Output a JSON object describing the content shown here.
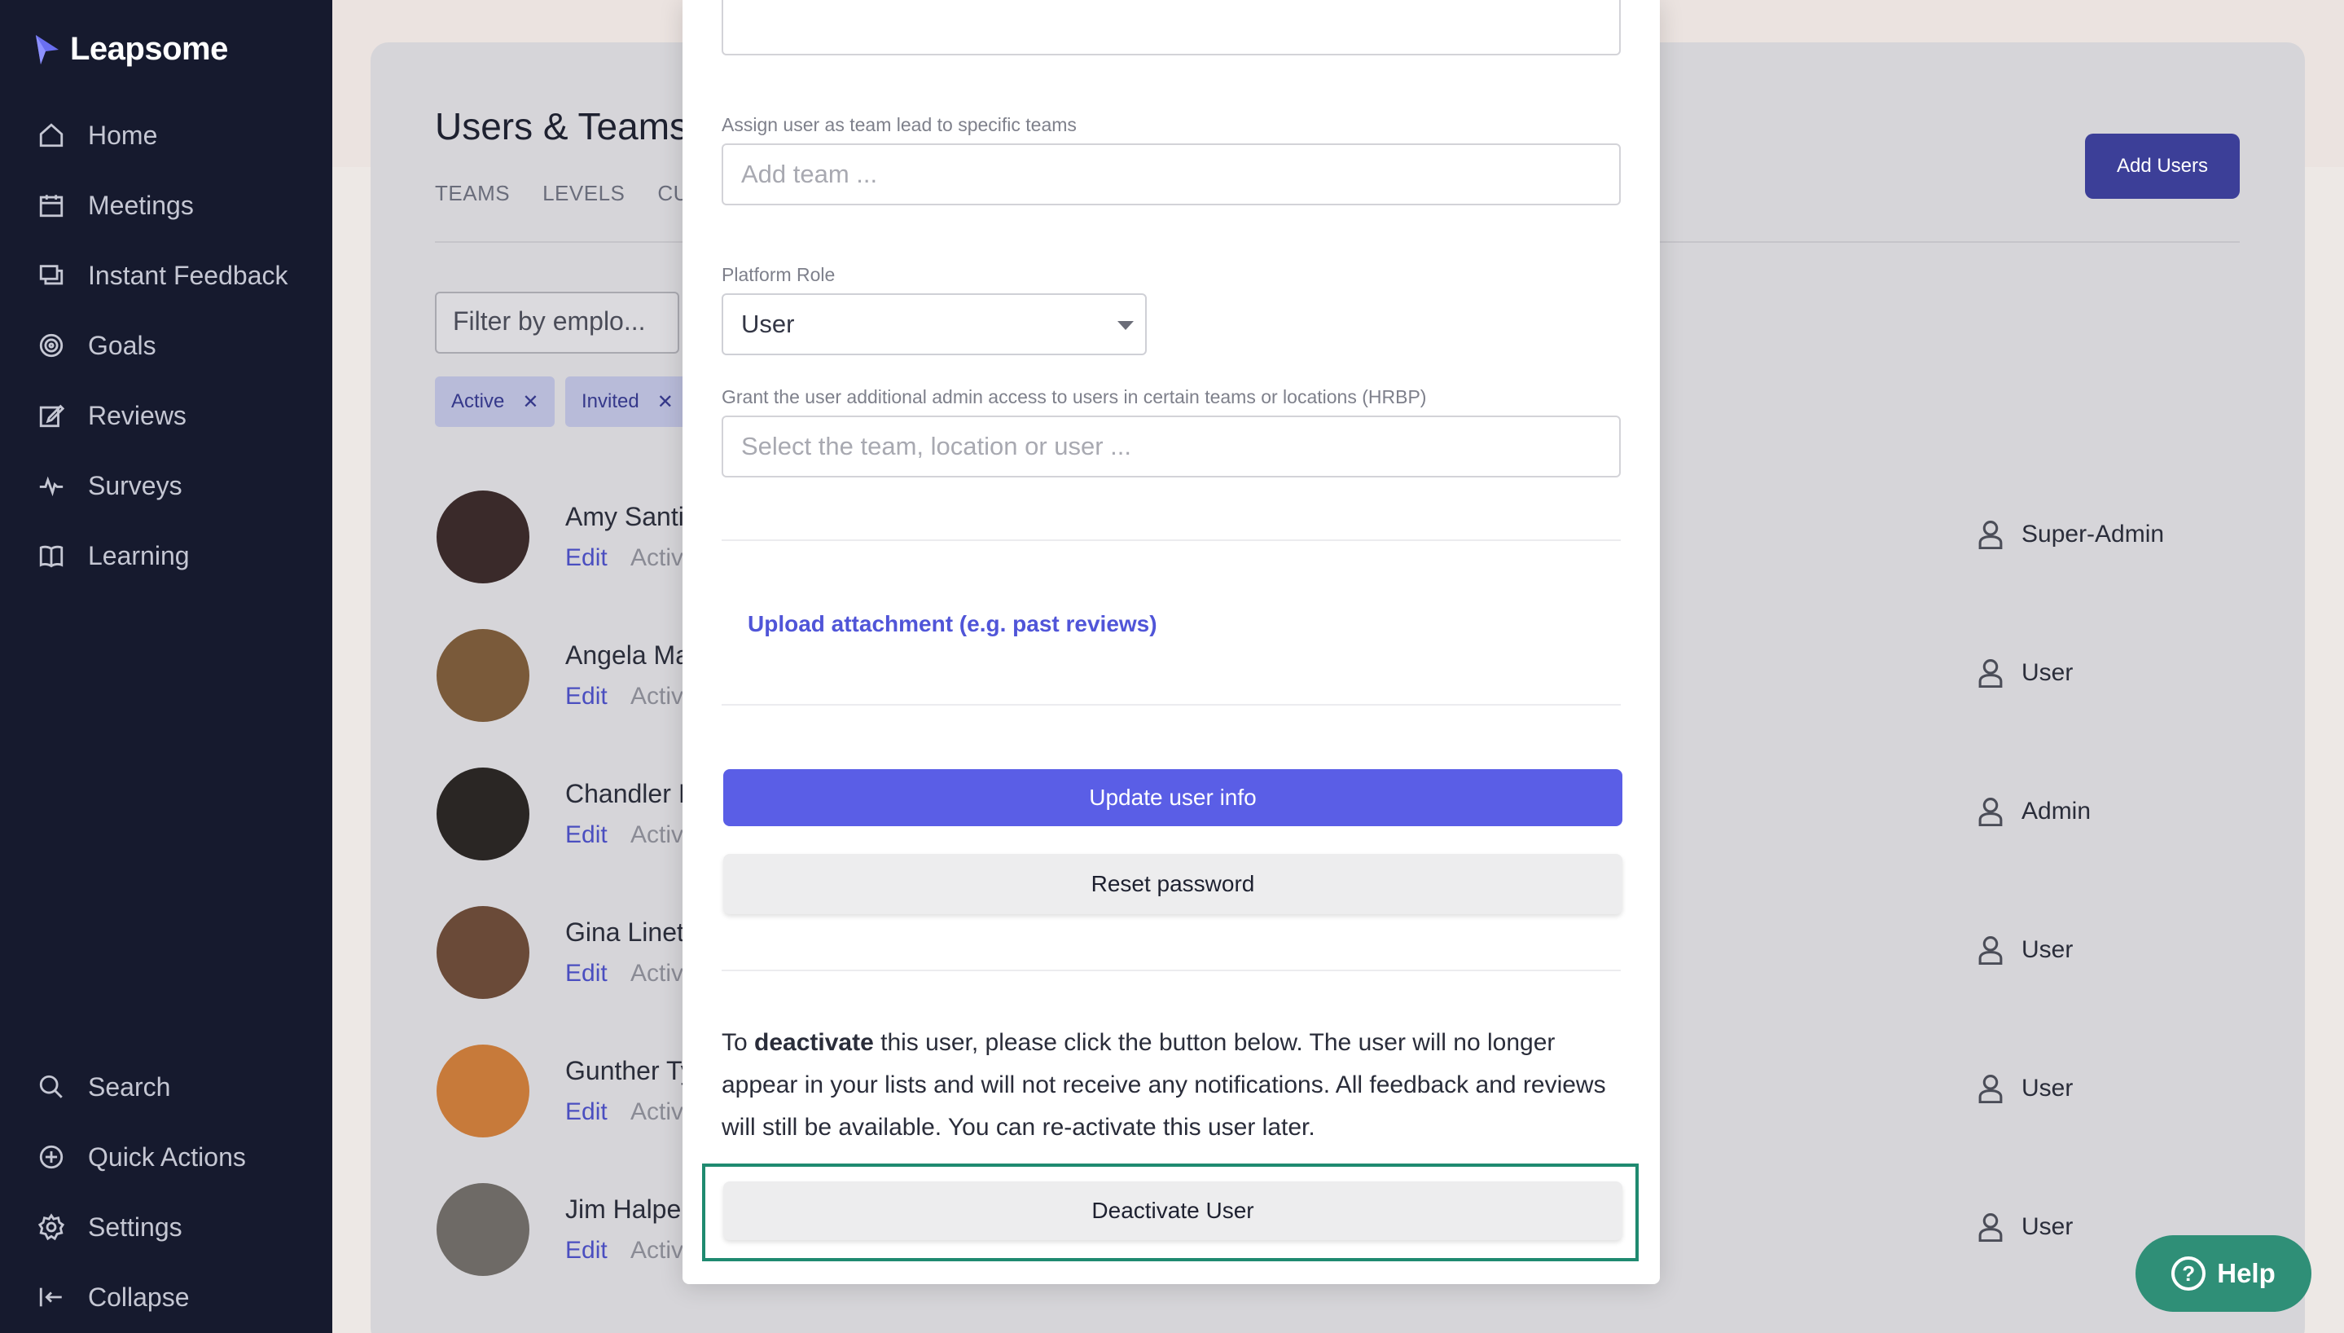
{
  "app": {
    "name": "Leapsome"
  },
  "sidebar": {
    "top_items": [
      {
        "label": "Home",
        "icon": "home-icon"
      },
      {
        "label": "Meetings",
        "icon": "calendar-icon"
      },
      {
        "label": "Instant Feedback",
        "icon": "chat-icon"
      },
      {
        "label": "Goals",
        "icon": "target-icon"
      },
      {
        "label": "Reviews",
        "icon": "edit-icon"
      },
      {
        "label": "Surveys",
        "icon": "pulse-icon"
      },
      {
        "label": "Learning",
        "icon": "book-icon"
      }
    ],
    "bottom_items": [
      {
        "label": "Search",
        "icon": "search-icon"
      },
      {
        "label": "Quick Actions",
        "icon": "plus-circle-icon"
      },
      {
        "label": "Settings",
        "icon": "gear-icon"
      },
      {
        "label": "Collapse",
        "icon": "collapse-icon"
      }
    ]
  },
  "page": {
    "title": "Users & Teams",
    "tabs": [
      "TEAMS",
      "LEVELS",
      "CUS"
    ],
    "add_users_label": "Add Users",
    "filter_placeholder": "Filter by emplo...",
    "chips": [
      "Active",
      "Invited"
    ],
    "users": [
      {
        "name": "Amy Santi",
        "edit": "Edit",
        "status": "Activ",
        "role": "Super-Admin",
        "avatar_color": "#3a2a2a"
      },
      {
        "name": "Angela Ma",
        "edit": "Edit",
        "status": "Activ",
        "role": "User",
        "avatar_color": "#7a5a3a"
      },
      {
        "name": "Chandler I",
        "edit": "Edit",
        "status": "Activ",
        "role": "Admin",
        "avatar_color": "#2a2624"
      },
      {
        "name": "Gina Linet",
        "edit": "Edit",
        "status": "Activ",
        "role": "User",
        "avatar_color": "#6a4a38"
      },
      {
        "name": "Gunther Ty",
        "edit": "Edit",
        "status": "Activ",
        "role": "User",
        "avatar_color": "#c77a3a"
      },
      {
        "name": "Jim Halpe",
        "edit": "Edit",
        "status": "Activ",
        "role": "User",
        "avatar_color": "#6e6a66"
      }
    ]
  },
  "modal": {
    "team_lead_label": "Assign user as team lead to specific teams",
    "team_lead_placeholder": "Add team ...",
    "platform_role_label": "Platform Role",
    "platform_role_value": "User",
    "hrbp_label": "Grant the user additional admin access to users in certain teams or locations (HRBP)",
    "hrbp_placeholder": "Select the team, location or user ...",
    "upload_link": "Upload attachment (e.g. past reviews)",
    "update_button": "Update user info",
    "reset_button": "Reset password",
    "deactivate_text_before": "To ",
    "deactivate_text_bold": "deactivate",
    "deactivate_text_after": " this user, please click the button below. The user will no longer appear in your lists and will not receive any notifications. All feedback and reviews will still be available. You can re-activate this user later.",
    "deactivate_button": "Deactivate User"
  },
  "help": {
    "label": "Help"
  },
  "colors": {
    "sidebar_bg": "#161a2e",
    "primary": "#5a5ee6",
    "highlight": "#1f8a70",
    "help_bg": "#2f8f77"
  }
}
